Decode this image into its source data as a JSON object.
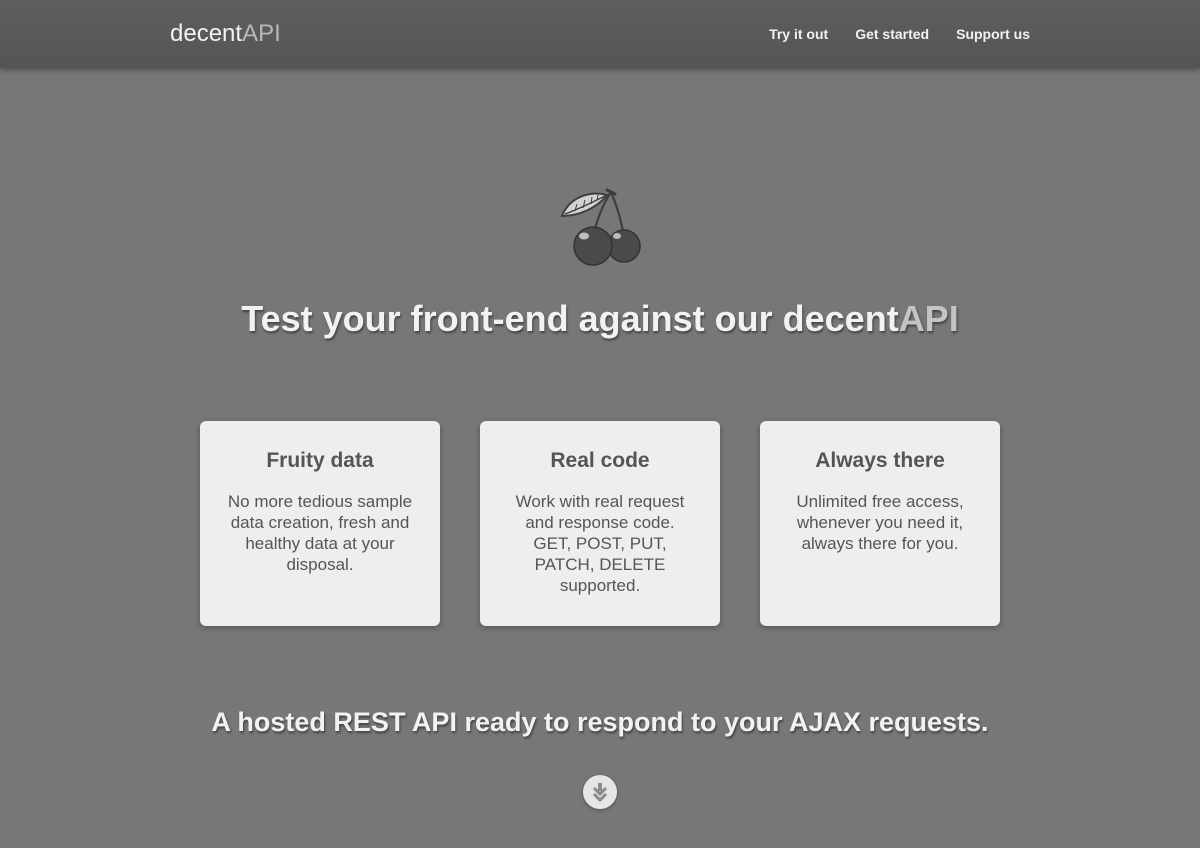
{
  "header": {
    "brand_main": "decent",
    "brand_accent": "API",
    "nav": [
      {
        "label": "Try it out"
      },
      {
        "label": "Get started"
      },
      {
        "label": "Support us"
      }
    ]
  },
  "hero": {
    "logo_icon": "cherry-icon",
    "headline_main": "Test your front-end against our decent",
    "headline_accent": "API"
  },
  "features": [
    {
      "title": "Fruity data",
      "text": "No more tedious sample data creation, fresh and healthy data at your disposal."
    },
    {
      "title": "Real code",
      "text": "Work with real request and response code. GET, POST, PUT, PATCH, DELETE supported."
    },
    {
      "title": "Always there",
      "text": "Unlimited free access, whenever you need it, always there for you."
    }
  ],
  "subline": "A hosted REST API ready to respond to your AJAX requests.",
  "scroll_icon": "chevron-down-icon",
  "colors": {
    "background": "#777777",
    "header": "#585858",
    "card": "#eeeeee",
    "card_text": "#555555",
    "accent": "#c4c4c4"
  }
}
